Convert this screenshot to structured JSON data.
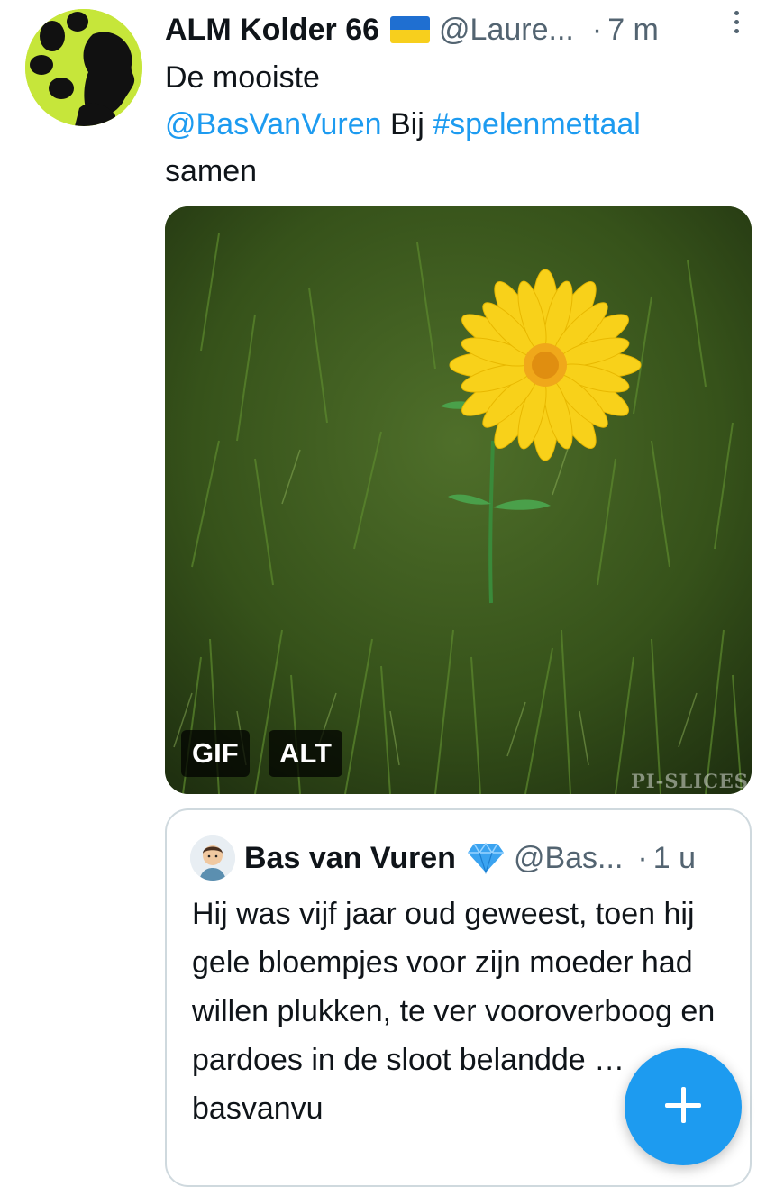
{
  "tweet": {
    "author": {
      "display_name": "ALM Kolder 66",
      "handle": "@Laure...",
      "flag": "ukraine-flag",
      "time": "7 m",
      "dot": "·"
    },
    "text": {
      "line1": "De mooiste",
      "mention": "@BasVanVuren",
      "mid": " Bij ",
      "hashtag": "#spelenmettaal",
      "line3": "samen"
    },
    "media": {
      "gif_badge": "GIF",
      "alt_badge": "ALT",
      "watermark": "PI-SLICES"
    }
  },
  "quoted_tweet": {
    "display_name": "Bas van Vuren",
    "verified_icon": "diamond-icon",
    "handle": "@Bas...",
    "dot": "·",
    "time": "1 u",
    "text": "Hij was vijf jaar oud geweest, toen hij gele bloempjes voor zijn moeder had willen plukken, te ver vooroverboog en pardoes in de sloot belandde … basvanvu"
  },
  "fab": {
    "icon": "plus-icon"
  },
  "colors": {
    "link": "#1d9bf0",
    "secondary_text": "#536471",
    "text": "#0f1419",
    "fab": "#1d9bf0",
    "quote_border": "#cfd9de"
  }
}
